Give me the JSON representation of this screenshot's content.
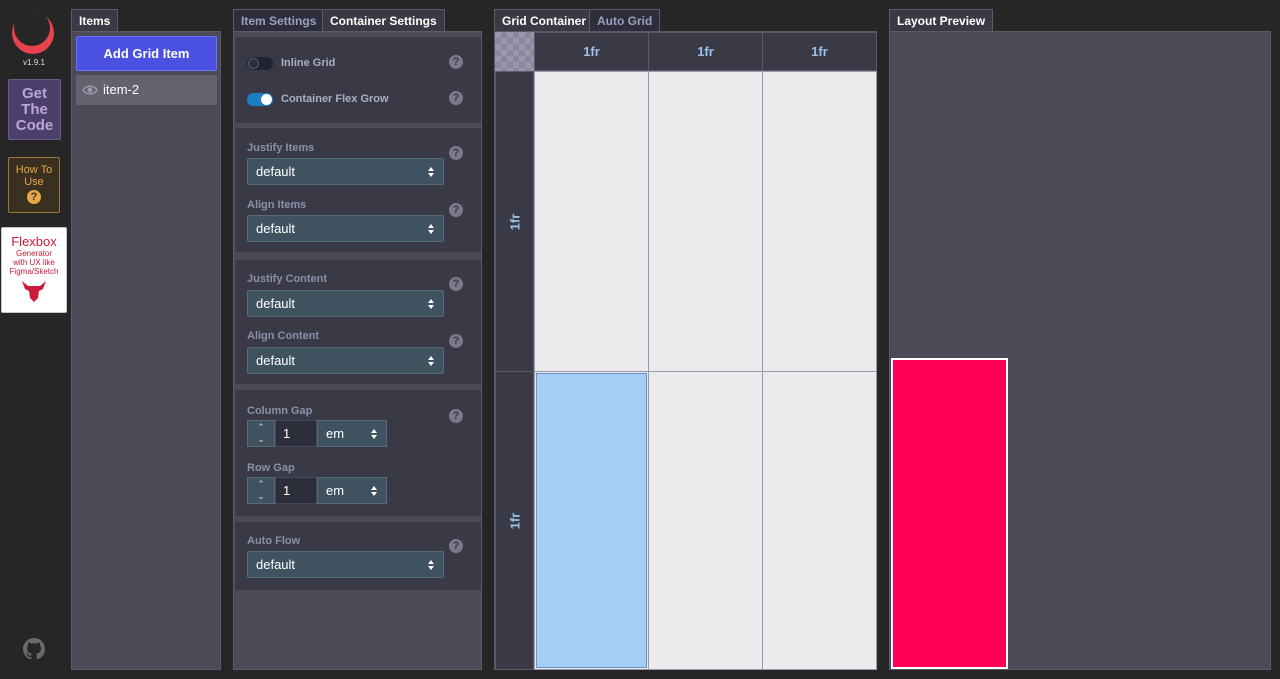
{
  "app": {
    "version": "v1.9.1"
  },
  "rail": {
    "get_code": "Get The Code",
    "how_to_use": "How To Use",
    "flexbox_title": "Flexbox",
    "flexbox_sub1": "Generator",
    "flexbox_sub2": "with UX like",
    "flexbox_sub3": "Figma/Sketch"
  },
  "items": {
    "tab": "Items",
    "add_button": "Add Grid Item",
    "list": [
      {
        "label": "item-2"
      }
    ]
  },
  "settings": {
    "tabs": [
      "Item Settings",
      "Container Settings"
    ],
    "active_tab": "Container Settings",
    "inline_grid": {
      "label": "Inline Grid",
      "on": false
    },
    "flex_grow": {
      "label": "Container Flex Grow",
      "on": true
    },
    "justify_items": {
      "label": "Justify Items",
      "value": "default"
    },
    "align_items": {
      "label": "Align Items",
      "value": "default"
    },
    "justify_content": {
      "label": "Justify Content",
      "value": "default"
    },
    "align_content": {
      "label": "Align Content",
      "value": "default"
    },
    "column_gap": {
      "label": "Column Gap",
      "value": "1",
      "unit": "em"
    },
    "row_gap": {
      "label": "Row Gap",
      "value": "1",
      "unit": "em"
    },
    "auto_flow": {
      "label": "Auto Flow",
      "value": "default"
    }
  },
  "grid": {
    "tabs": [
      "Grid Container",
      "Auto Grid"
    ],
    "columns": [
      "1fr",
      "1fr",
      "1fr"
    ],
    "rows": [
      "1fr",
      "1fr"
    ]
  },
  "preview": {
    "tab": "Layout Preview"
  },
  "colors": {
    "accent": "#4a50e0",
    "selected_cell": "#a6cdf5",
    "preview_item": "#ff0054"
  }
}
